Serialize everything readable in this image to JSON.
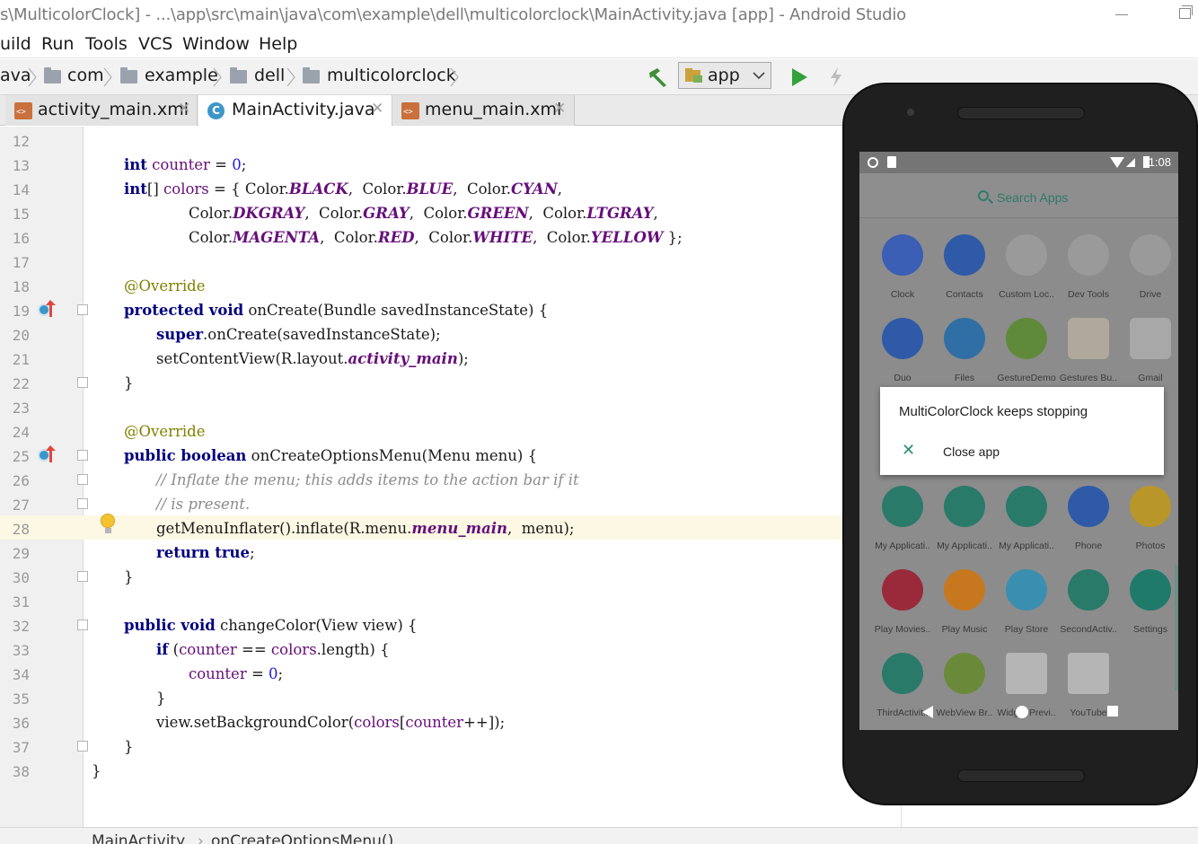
{
  "window": {
    "title": "s\\MulticolorClock] - ...\\app\\src\\main\\java\\com\\example\\dell\\multicolorclock\\MainActivity.java [app] - Android Studio"
  },
  "menu": {
    "items": [
      "uild",
      "Run",
      "Tools",
      "VCS",
      "Window",
      "Help"
    ]
  },
  "nav": {
    "crumbs": [
      "ava",
      "com",
      "example",
      "dell",
      "multicolorclock"
    ],
    "run_config": "app"
  },
  "tabs": [
    {
      "label": "activity_main.xml",
      "type": "xml",
      "active": false
    },
    {
      "label": "MainActivity.java",
      "type": "class",
      "active": true
    },
    {
      "label": "menu_main.xml",
      "type": "xml",
      "active": false
    }
  ],
  "editor": {
    "line_numbers": [
      "12",
      "13",
      "14",
      "15",
      "16",
      "17",
      "18",
      "19",
      "20",
      "21",
      "22",
      "23",
      "24",
      "25",
      "26",
      "27",
      "28",
      "29",
      "30",
      "31",
      "32",
      "33",
      "34",
      "35",
      "36",
      "37",
      "38"
    ],
    "current_line": "28"
  },
  "code": {
    "l13_t1": "int",
    "l13_t2": "counter",
    "l13_t3": " = ",
    "l13_t4": "0",
    "l13_t5": ";",
    "l14_t1": "int",
    "l14_t2": "[] ",
    "l14_t3": "colors",
    "l14_t4": " = { Color.",
    "l14_t5": "BLACK",
    "l14_t6": ",  Color.",
    "l14_t7": "BLUE",
    "l14_t8": ",  Color.",
    "l14_t9": "CYAN",
    "l14_t10": ",",
    "l15_t1": "Color.",
    "l15_t2": "DKGRAY",
    "l15_t3": ",  Color.",
    "l15_t4": "GRAY",
    "l15_t5": ",  Color.",
    "l15_t6": "GREEN",
    "l15_t7": ",  Color.",
    "l15_t8": "LTGRAY",
    "l15_t9": ",",
    "l16_t1": "Color.",
    "l16_t2": "MAGENTA",
    "l16_t3": ",  Color.",
    "l16_t4": "RED",
    "l16_t5": ",  Color.",
    "l16_t6": "WHITE",
    "l16_t7": ",  Color.",
    "l16_t8": "YELLOW",
    "l16_t9": " };",
    "l18": "@Override",
    "l19_t1": "protected void",
    "l19_t2": " onCreate(Bundle savedInstanceState) {",
    "l20_t1": "super",
    "l20_t2": ".onCreate(savedInstanceState);",
    "l21_t1": "setContentView(R.layout.",
    "l21_t2": "activity_main",
    "l21_t3": ");",
    "l22": "}",
    "l24": "@Override",
    "l25_t1": "public boolean",
    "l25_t2": " onCreateOptionsMenu(Menu menu) {",
    "l26": "// Inflate the menu; this adds items to the action bar if it",
    "l27": "// is present.",
    "l28_t1": "getMenuInflater().inflate(R.menu.",
    "l28_t2": "menu_main",
    "l28_t3": ",  menu);",
    "l29_t1": "return true",
    "l29_t2": ";",
    "l30": "}",
    "l32_t1": "public void",
    "l32_t2": " changeColor(View view) {",
    "l33_t1": "if",
    "l33_t2": " (",
    "l33_t3": "counter",
    "l33_t4": " == ",
    "l33_t5": "colors",
    "l33_t6": ".length) {",
    "l34_t1": "counter",
    "l34_t2": " = ",
    "l34_t3": "0",
    "l34_t4": ";",
    "l35": "}",
    "l36_t1": "view.setBackgroundColor(",
    "l36_t2": "colors",
    "l36_t3": "[",
    "l36_t4": "counter",
    "l36_t5": "++]);",
    "l37": "}",
    "l38": "}"
  },
  "bottom_breadcrumb": [
    "MainActivity",
    "onCreateOptionsMenu()"
  ],
  "emulator": {
    "status_time": "1:08",
    "search_label": "Search Apps",
    "apps_row1": [
      "Clock",
      "Contacts",
      "Custom Loc..",
      "Dev Tools",
      "Drive"
    ],
    "apps_row2": [
      "Duo",
      "Files",
      "GestureDemo",
      "Gestures Bu..",
      "Gmail"
    ],
    "apps_row3": [
      "My Applicati..",
      "My Applicati..",
      "My Applicati..",
      "Phone",
      "Photos"
    ],
    "apps_row4": [
      "Play Movies..",
      "Play Music",
      "Play Store",
      "SecondActiv..",
      "Settings"
    ],
    "apps_row5": [
      "ThirdActivit..",
      "WebView Br..",
      "Widget Previ..",
      "",
      "YouTube"
    ],
    "dialog_title": "MultiColorClock keeps stopping",
    "dialog_action": "Close app"
  },
  "colors": {
    "keyword": "#000080",
    "field": "#660e7a",
    "number": "#1c1cd8",
    "annotation": "#808000",
    "comment": "#8c8c8c",
    "current_line": "#fcf8e3",
    "dialog_accent": "#2e8c77"
  }
}
